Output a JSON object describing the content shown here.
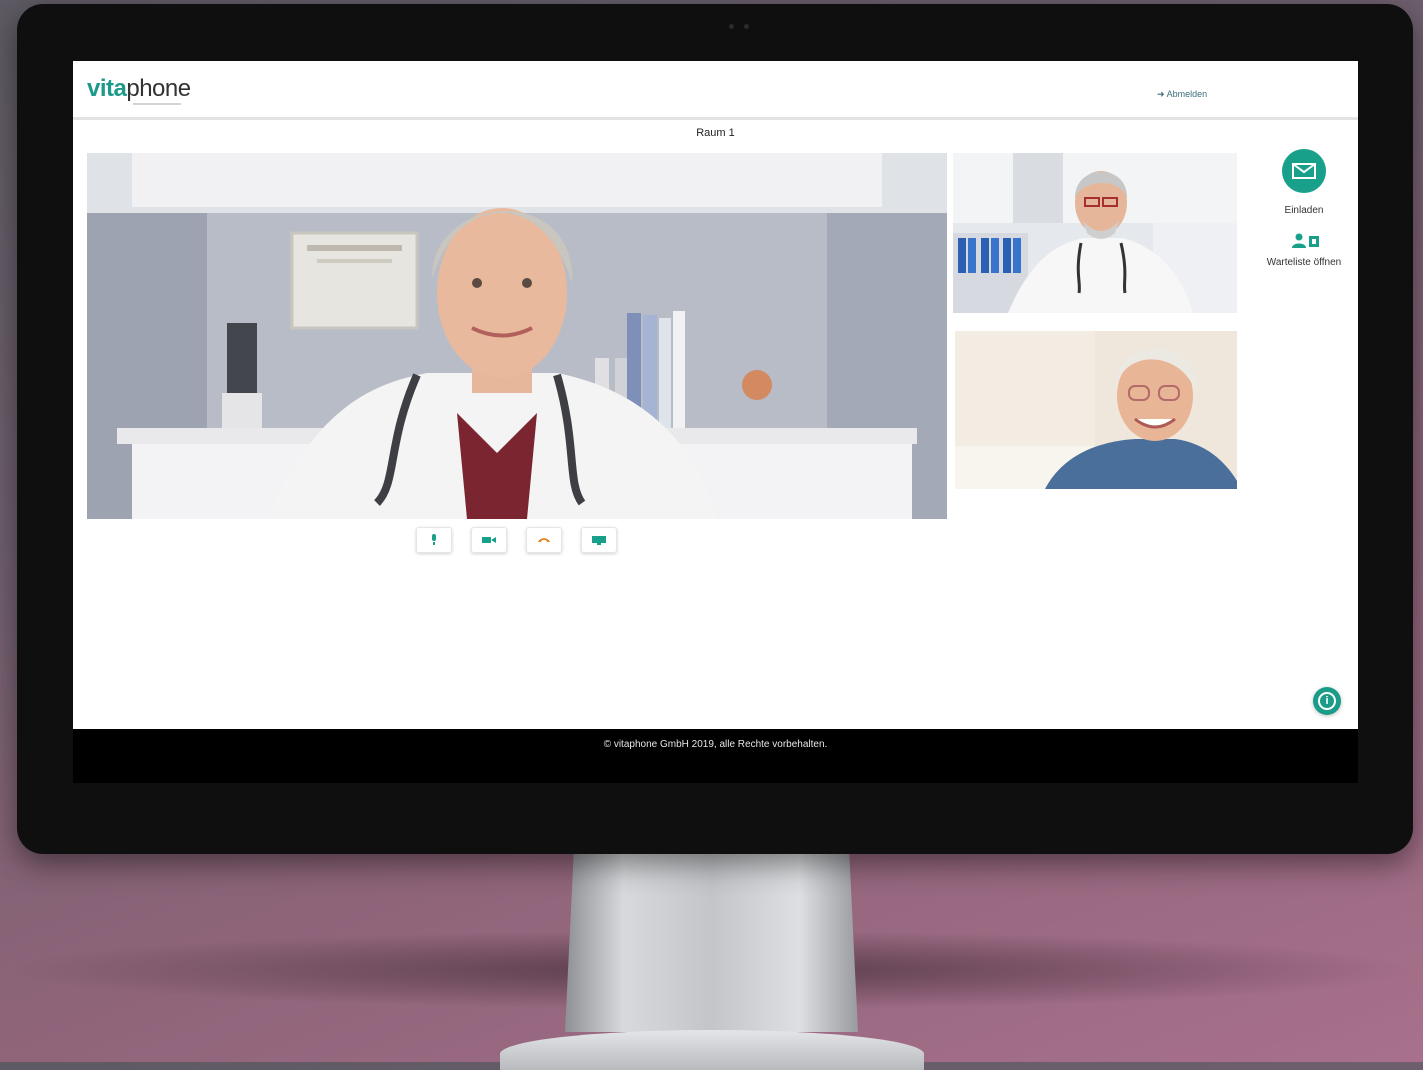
{
  "header": {
    "logo_part1": "vita",
    "logo_part2": "phone",
    "logout_label": "Abmelden"
  },
  "room": {
    "title": "Raum 1"
  },
  "actions": {
    "invite_label": "Einladen",
    "waitlist_label": "Warteliste öffnen"
  },
  "controls": [
    "microphone",
    "camera",
    "hang-up",
    "screen-share"
  ],
  "footer": {
    "copyright": "© vitaphone GmbH 2019, alle Rechte vorbehalten."
  },
  "colors": {
    "accent": "#18a08b",
    "hangup": "#e67e22"
  }
}
